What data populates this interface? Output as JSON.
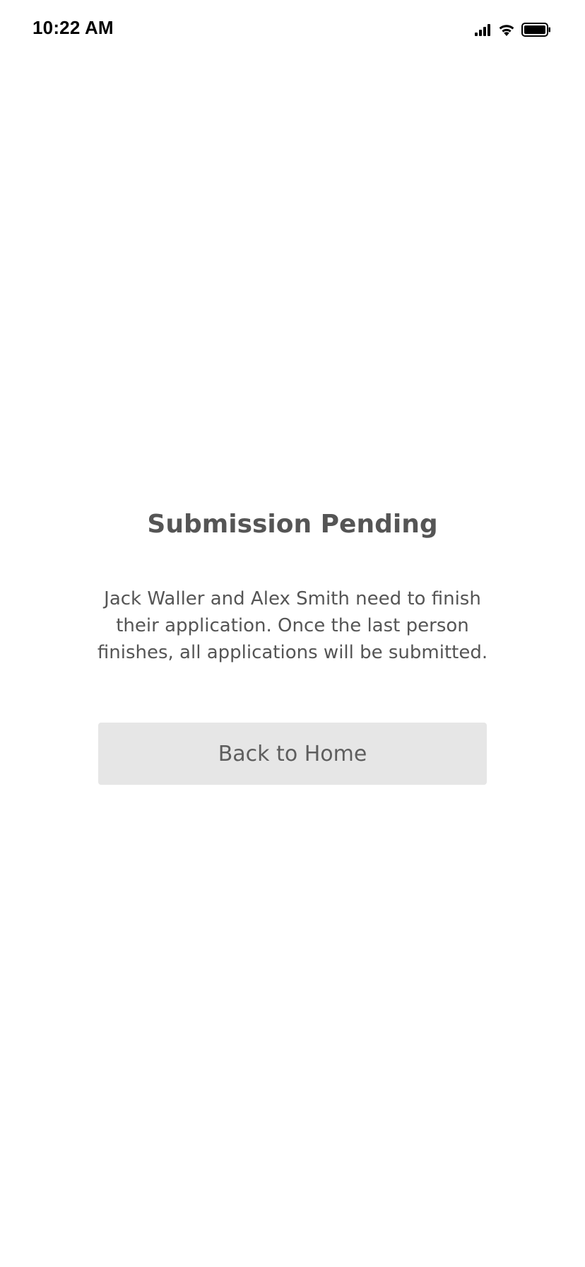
{
  "status_bar": {
    "time": "10:22 AM",
    "icons": [
      "signal-icon",
      "wifi-icon",
      "battery-icon"
    ]
  },
  "main": {
    "title": "Submission Pending",
    "message": "Jack Waller and Alex Smith need to finish their application. Once the last person finishes, all applications will be submitted.",
    "back_button_label": "Back to Home"
  },
  "colors": {
    "background": "#ffffff",
    "text": "#555555",
    "button_background": "#e6e6e6",
    "button_text": "#5e5e5e"
  }
}
